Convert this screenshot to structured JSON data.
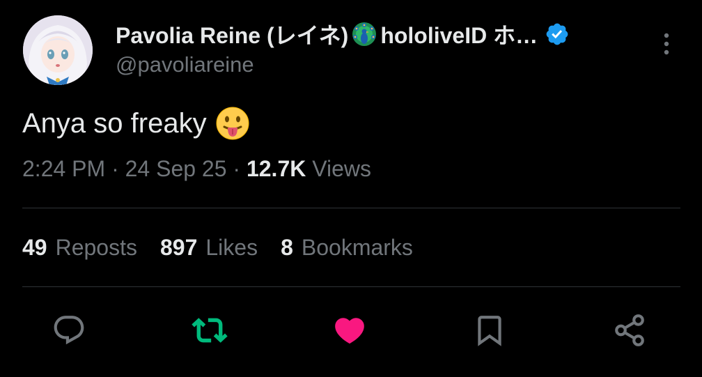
{
  "author": {
    "display_name": "Pavolia Reine (レイネ)",
    "name_suffix": "hololiveID ホ…",
    "handle": "@pavoliareine",
    "verified": true,
    "avatar_icon": "anime-avatar"
  },
  "tweet": {
    "text": "Anya so freaky",
    "emoji": "face-with-tongue-emoji"
  },
  "meta": {
    "time": "2:24 PM",
    "sep1": "·",
    "date": "24 Sep 25",
    "sep2": "·",
    "views_count": "12.7K",
    "views_label": "Views"
  },
  "stats": {
    "reposts_count": "49",
    "reposts_label": "Reposts",
    "likes_count": "897",
    "likes_label": "Likes",
    "bookmarks_count": "8",
    "bookmarks_label": "Bookmarks"
  },
  "actions": [
    "reply-icon",
    "repost-icon",
    "like-icon",
    "bookmark-icon",
    "share-icon"
  ],
  "colors": {
    "background": "#000000",
    "text_primary": "#e7e9ea",
    "text_secondary": "#71767b",
    "divider": "#2f3336",
    "verified_blue": "#1d9bf0",
    "repost_green": "#00ba7c",
    "like_pink": "#f91880"
  }
}
